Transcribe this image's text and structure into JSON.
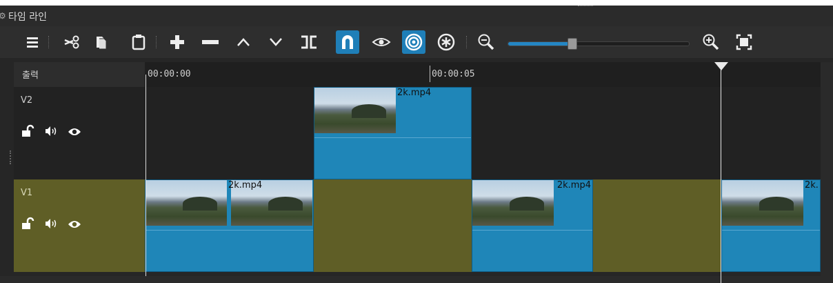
{
  "window": {
    "title": "타임 라인",
    "title_icon": "gear-icon"
  },
  "toolbar": {
    "items": [
      {
        "name": "menu-icon"
      },
      {
        "name": "cut-icon"
      },
      {
        "name": "copy-icon"
      },
      {
        "name": "paste-icon"
      },
      {
        "name": "append-icon"
      },
      {
        "name": "remove-icon"
      },
      {
        "name": "lift-icon"
      },
      {
        "name": "overwrite-icon"
      },
      {
        "name": "split-icon"
      },
      {
        "name": "snap-icon",
        "active": true
      },
      {
        "name": "scrub-icon"
      },
      {
        "name": "ripple-icon",
        "active": true
      },
      {
        "name": "ripple-all-icon"
      },
      {
        "name": "zoom-out-icon"
      },
      {
        "name": "zoom-in-icon"
      },
      {
        "name": "zoom-fit-icon"
      }
    ],
    "zoom_level": 0.35,
    "accent_color": "#1f7fb8"
  },
  "header": {
    "output_label": "출력"
  },
  "ruler": {
    "ticks": [
      "00:00:00",
      "00:00:05"
    ]
  },
  "tracks": [
    {
      "name": "V2",
      "icons": [
        "lock-icon",
        "audio-icon",
        "eye-icon"
      ],
      "color": "#222222",
      "clips": [
        {
          "name": "2k.mp4"
        }
      ]
    },
    {
      "name": "V1",
      "icons": [
        "lock-icon",
        "audio-icon",
        "eye-icon"
      ],
      "color": "#5f5e26",
      "clips": [
        {
          "name": "2k.mp4"
        },
        {
          "name": "2k.mp4"
        },
        {
          "name": "2k."
        }
      ]
    }
  ],
  "colors": {
    "clip": "#1f86b8",
    "track_selected": "#5f5e26",
    "panel": "#262626"
  }
}
